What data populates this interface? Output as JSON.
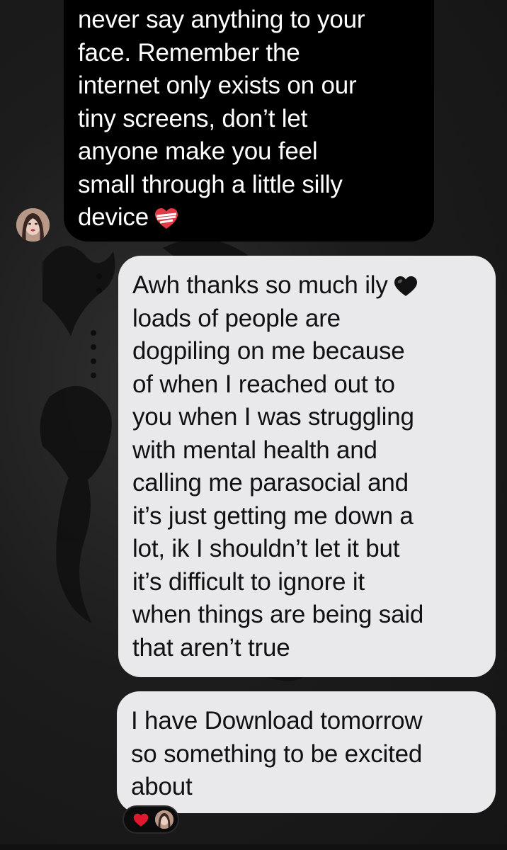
{
  "conversation": {
    "incoming_message": {
      "lines": [
        "never say anything to your",
        "face. Remember the",
        "internet only exists on our",
        "tiny screens, don’t let",
        "anyone make you feel",
        "small through a little silly",
        "device"
      ],
      "emoji": "mending-heart-icon"
    },
    "outgoing_messages": [
      {
        "lines": [
          "Awh thanks so much ily",
          "loads of people are",
          "dogpiling on me because",
          "of when I reached out to",
          "you when I was struggling",
          "with mental health and",
          "calling me parasocial and",
          "it’s just getting me down a",
          "lot, ik I shouldn’t let it but",
          "it’s difficult to ignore it",
          "when things are being said",
          "that aren’t true"
        ],
        "emoji": "black-heart-icon"
      },
      {
        "lines": [
          "I have Download tomorrow",
          "so something to be excited",
          "about"
        ],
        "reaction": "red-heart-icon"
      }
    ]
  },
  "colors": {
    "incoming_bubble": "#000000",
    "outgoing_bubble": "#e9e9eb",
    "background": "#1c1c1c",
    "reaction_heart": "#e0182d"
  }
}
